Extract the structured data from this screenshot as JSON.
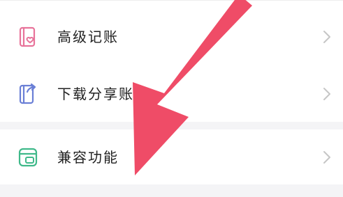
{
  "settings": {
    "items": [
      {
        "label": "高级记账",
        "icon": "book-heart-icon",
        "icon_color": "#e8739a"
      },
      {
        "label": "下载分享账本",
        "icon": "share-book-icon",
        "icon_color": "#6a7fd6"
      },
      {
        "label": "兼容功能",
        "icon": "window-icon",
        "icon_color": "#3fb98a"
      }
    ]
  },
  "annotation": {
    "arrow_color": "#ef4c67"
  }
}
